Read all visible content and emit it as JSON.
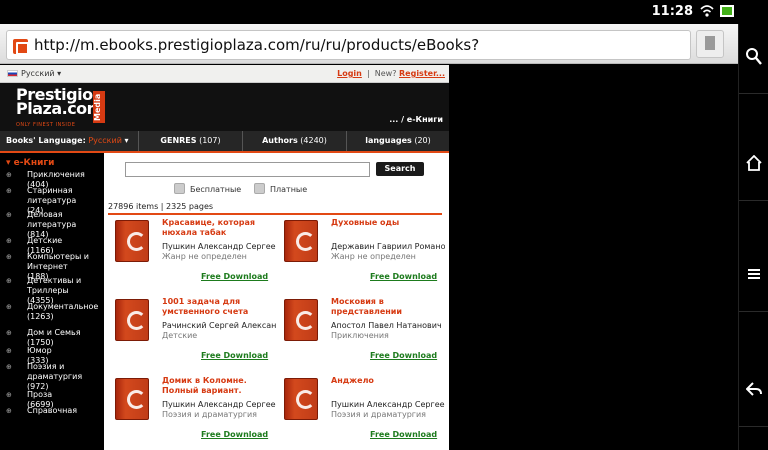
{
  "status": {
    "time": "11:28"
  },
  "browser": {
    "url": "http://m.ebooks.prestigioplaza.com/ru/ru/products/eBooks?"
  },
  "site": {
    "language_label": "Русский",
    "login": "Login",
    "new_text": "New?",
    "register": "Register...",
    "separator": "|",
    "logo_line1": "Prestigio",
    "logo_line2": "Plaza.com",
    "logo_tagline": "ONLY FINEST INSIDE",
    "logo_badge": "Media",
    "breadcrumb": "... / e-Книги"
  },
  "nav": {
    "books_language_label": "Books' Language:",
    "books_language_value": "Русский",
    "genres_label": "GENRES",
    "genres_count": "(107)",
    "authors_label": "Authors",
    "authors_count": "(4240)",
    "languages_label": "languages",
    "languages_count": "(20)"
  },
  "sidebar": {
    "title": "e-Книги",
    "items": [
      {
        "label": "Приключения",
        "count": "(404)"
      },
      {
        "label": "Старинная литература",
        "count": "(24)"
      },
      {
        "label": "Деловая литература",
        "count": "(814)"
      },
      {
        "label": "Детские",
        "count": "(1166)"
      },
      {
        "label": "Компьютеры и Интернет",
        "count": "(188)"
      },
      {
        "label": "Детективы и Триллеры",
        "count": "(4355)"
      },
      {
        "label": "Документальное",
        "count": "(1263)"
      },
      {
        "label": "Дом и Семья",
        "count": "(1750)"
      },
      {
        "label": "Юмор",
        "count": "(333)"
      },
      {
        "label": "Поэзия и драматургия",
        "count": "(972)"
      },
      {
        "label": "Проза",
        "count": "(6699)"
      },
      {
        "label": "Справочная",
        "count": ""
      }
    ]
  },
  "search": {
    "button": "Search",
    "filter_free": "Бесплатные",
    "filter_paid": "Платные",
    "result_count": "27896 items | 2325 pages"
  },
  "download_label": "Free Download",
  "books": [
    {
      "title": "Красавице, которая нюхала табак",
      "author": "Пушкин Александр Сергееви",
      "genre": "Жанр не определен"
    },
    {
      "title": "Духовные оды",
      "author": "Державин Гавриил Романов",
      "genre": "Жанр не определен"
    },
    {
      "title": "1001 задача для умственного счета",
      "author": "Рачинский Сергей Александ",
      "genre": "Детские"
    },
    {
      "title": "Московия в представлении",
      "author": "Апостол Павел Натанович",
      "genre": "Приключения"
    },
    {
      "title": "Домик в Коломне. Полный вариант.",
      "author": "Пушкин Александр Сергееви",
      "genre": "Поэзия и драматургия"
    },
    {
      "title": "Анджело",
      "author": "Пушкин Александр Сергееви",
      "genre": "Поэзия и драматургия"
    }
  ]
}
